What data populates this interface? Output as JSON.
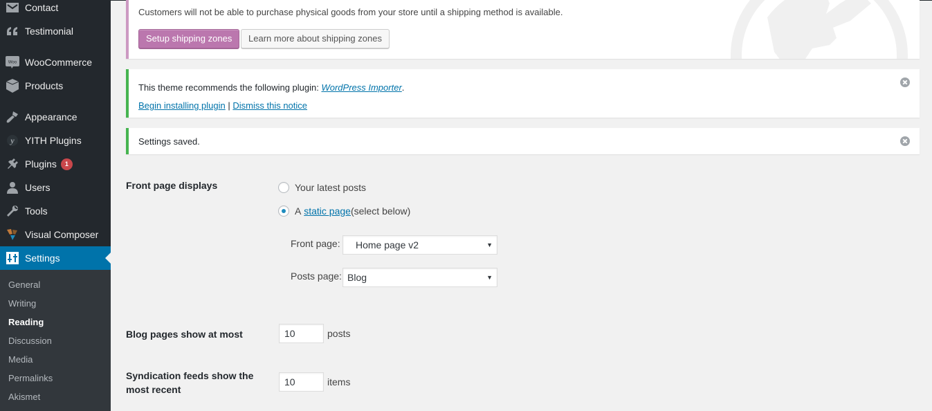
{
  "sidebar": {
    "items": [
      {
        "label": "Contact",
        "icon": "envelope-icon"
      },
      {
        "label": "Testimonial",
        "icon": "quote-icon"
      },
      {
        "label": "WooCommerce",
        "icon": "woocommerce-icon"
      },
      {
        "label": "Products",
        "icon": "box-icon"
      },
      {
        "label": "Appearance",
        "icon": "paintbrush-icon"
      },
      {
        "label": "YITH Plugins",
        "icon": "yith-icon"
      },
      {
        "label": "Plugins",
        "icon": "plug-icon",
        "badge": "1"
      },
      {
        "label": "Users",
        "icon": "user-icon"
      },
      {
        "label": "Tools",
        "icon": "wrench-icon"
      },
      {
        "label": "Visual Composer",
        "icon": "visual-composer-icon"
      },
      {
        "label": "Settings",
        "icon": "sliders-icon",
        "active": true
      }
    ],
    "submenu": [
      {
        "label": "General"
      },
      {
        "label": "Writing"
      },
      {
        "label": "Reading",
        "current": true
      },
      {
        "label": "Discussion"
      },
      {
        "label": "Media"
      },
      {
        "label": "Permalinks"
      },
      {
        "label": "Akismet"
      }
    ]
  },
  "notices": {
    "shipping": {
      "message": "Customers will not be able to purchase physical goods from your store until a shipping method is available.",
      "primary_button": "Setup shipping zones",
      "secondary_button": "Learn more about shipping zones"
    },
    "plugin": {
      "message_prefix": "This theme recommends the following plugin: ",
      "plugin_link": "WordPress Importer",
      "message_suffix": ".",
      "install_link": "Begin installing plugin",
      "separator": " | ",
      "dismiss_link": "Dismiss this notice"
    },
    "saved": {
      "message": "Settings saved."
    }
  },
  "form": {
    "front_page_displays": {
      "label": "Front page displays",
      "options": [
        {
          "label": "Your latest posts",
          "checked": false
        },
        {
          "prefix": "A ",
          "link": "static page",
          "suffix": " (select below)",
          "checked": true
        }
      ],
      "front_page": {
        "label": "Front page:",
        "value": "Home page v2"
      },
      "posts_page": {
        "label": "Posts page:",
        "value": "Blog"
      }
    },
    "blog_pages": {
      "label": "Blog pages show at most",
      "value": "10",
      "unit": "posts"
    },
    "syndication": {
      "label": "Syndication feeds show the most recent",
      "value": "10",
      "unit": "items"
    }
  },
  "colors": {
    "sidebar_bg": "#23282d",
    "submenu_bg": "#32373c",
    "active_bg": "#0073aa",
    "woo_purple": "#bb77ae",
    "success_green": "#46b450",
    "link": "#0073aa"
  }
}
